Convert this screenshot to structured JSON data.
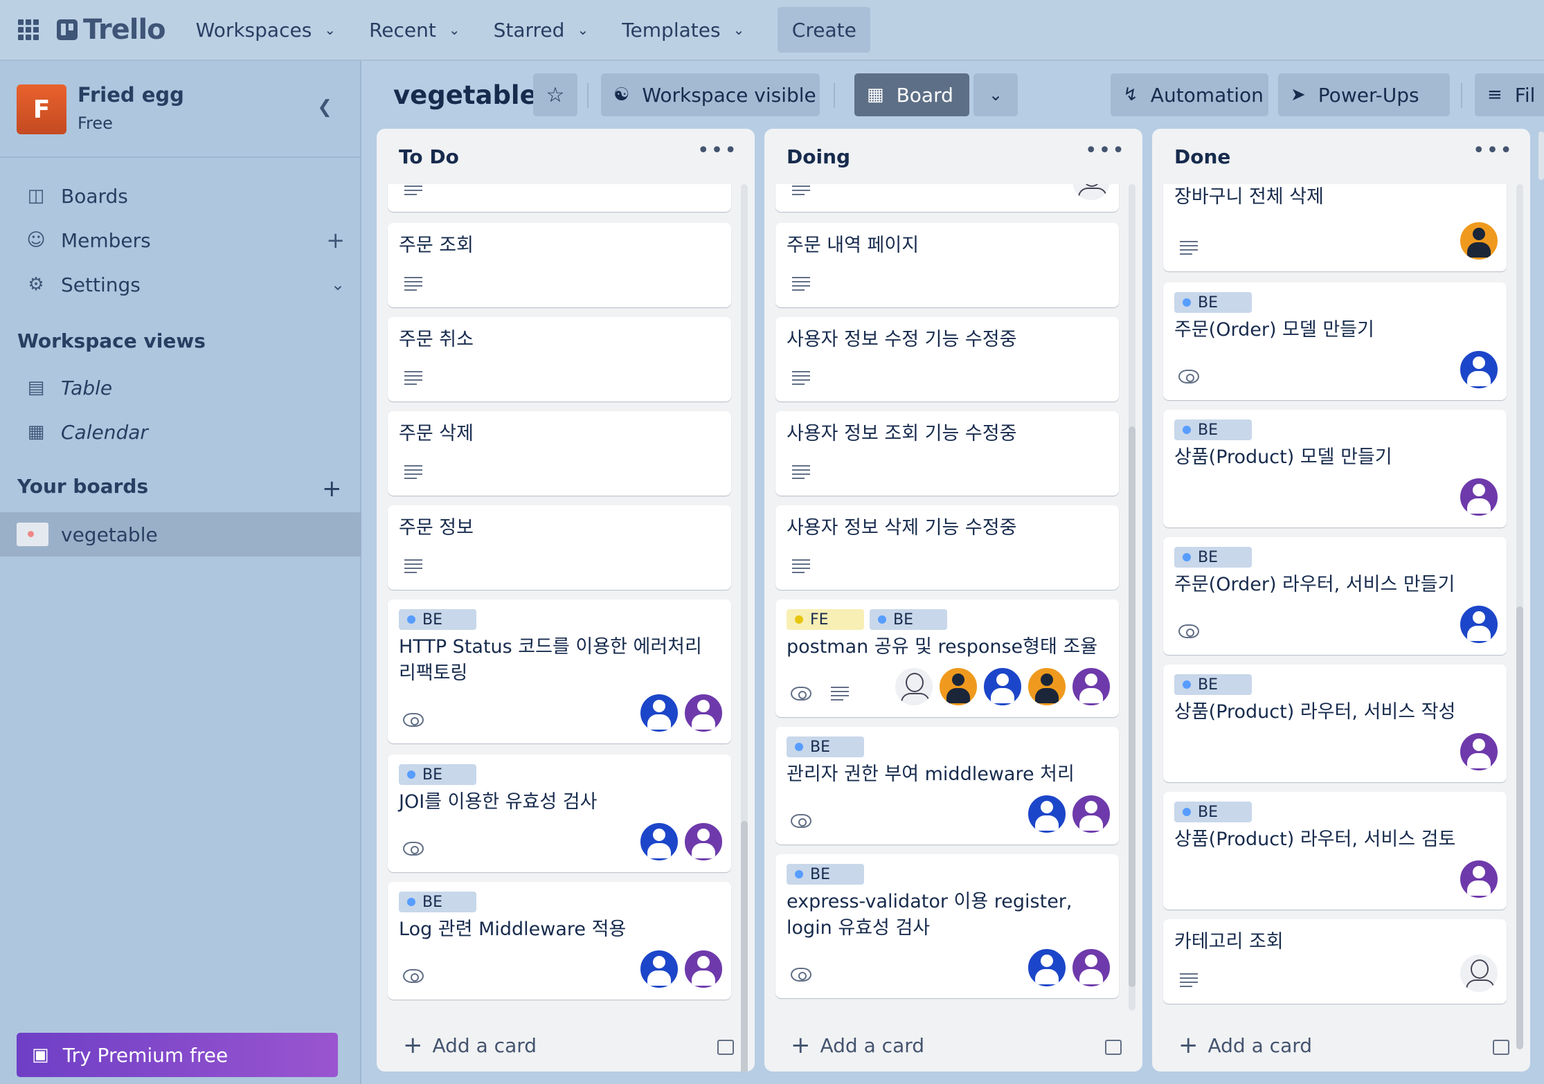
{
  "topbar": {
    "logo": "Trello",
    "nav": [
      "Workspaces",
      "Recent",
      "Starred",
      "Templates"
    ],
    "create": "Create"
  },
  "sidebar": {
    "workspace_initial": "F",
    "workspace_name": "Fried egg",
    "workspace_plan": "Free",
    "items": [
      "Boards",
      "Members",
      "Settings"
    ],
    "views_title": "Workspace views",
    "views": [
      "Table",
      "Calendar"
    ],
    "your_boards_title": "Your boards",
    "boards": [
      "vegetable"
    ],
    "premium": "Try Premium free"
  },
  "board": {
    "title": "vegetable",
    "visibility": "Workspace visible",
    "view": "Board",
    "automation": "Automation",
    "powerups": "Power-Ups",
    "filter": "Fil"
  },
  "lists": [
    {
      "title": "To Do",
      "add": "Add a card",
      "cards": [
        {
          "title": "",
          "labels": [],
          "desc": true,
          "avatars": []
        },
        {
          "title": "주문 조회",
          "labels": [],
          "desc": true,
          "avatars": []
        },
        {
          "title": "주문 취소",
          "labels": [],
          "desc": true,
          "avatars": []
        },
        {
          "title": "주문 삭제",
          "labels": [],
          "desc": true,
          "avatars": []
        },
        {
          "title": "주문 정보",
          "labels": [],
          "desc": true,
          "avatars": []
        },
        {
          "title": "HTTP Status 코드를 이용한 에러처리 리팩토링",
          "labels": [
            "BE"
          ],
          "watch": true,
          "avatars": [
            "blue",
            "purple"
          ]
        },
        {
          "title": "JOI를 이용한 유효성 검사",
          "labels": [
            "BE"
          ],
          "watch": true,
          "avatars": [
            "blue",
            "purple"
          ]
        },
        {
          "title": "Log 관련 Middleware 적용",
          "labels": [
            "BE"
          ],
          "watch": true,
          "avatars": [
            "blue",
            "purple"
          ]
        }
      ]
    },
    {
      "title": "Doing",
      "add": "Add a card",
      "cards": [
        {
          "title": "",
          "labels": [],
          "desc": true,
          "avatars": [
            "face"
          ]
        },
        {
          "title": "주문 내역 페이지",
          "labels": [],
          "desc": true,
          "avatars": []
        },
        {
          "title": "사용자 정보 수정 기능 수정중",
          "labels": [],
          "desc": true,
          "avatars": []
        },
        {
          "title": "사용자 정보 조회 기능 수정중",
          "labels": [],
          "desc": true,
          "avatars": []
        },
        {
          "title": "사용자 정보 삭제 기능 수정중",
          "labels": [],
          "desc": true,
          "avatars": []
        },
        {
          "title": "postman 공유 및 response형태 조율",
          "labels": [
            "FE",
            "BE"
          ],
          "watch": true,
          "desc": true,
          "avatars": [
            "face",
            "orange",
            "blue",
            "orange",
            "purple"
          ]
        },
        {
          "title": "관리자 권한 부여 middleware 처리",
          "labels": [
            "BE"
          ],
          "watch": true,
          "avatars": [
            "blue",
            "purple"
          ]
        },
        {
          "title": "express-validator 이용 register, login 유효성 검사",
          "labels": [
            "BE"
          ],
          "watch": true,
          "avatars": [
            "blue",
            "purple"
          ]
        }
      ]
    },
    {
      "title": "Done",
      "add": "Add a card",
      "cards": [
        {
          "title": "장바구니 전체 삭제",
          "labels": [],
          "desc": true,
          "avatars": [
            "orange"
          ]
        },
        {
          "title": "주문(Order) 모델 만들기",
          "labels": [
            "BE"
          ],
          "watch": true,
          "avatars": [
            "blue"
          ]
        },
        {
          "title": "상품(Product) 모델 만들기",
          "labels": [
            "BE"
          ],
          "avatars": [
            "purple"
          ]
        },
        {
          "title": "주문(Order) 라우터, 서비스 만들기",
          "labels": [
            "BE"
          ],
          "watch": true,
          "avatars": [
            "blue"
          ]
        },
        {
          "title": "상품(Product) 라우터, 서비스 작성",
          "labels": [
            "BE"
          ],
          "avatars": [
            "purple"
          ]
        },
        {
          "title": "상품(Product) 라우터, 서비스 검토",
          "labels": [
            "BE"
          ],
          "avatars": [
            "purple"
          ]
        },
        {
          "title": "카테고리 조회",
          "labels": [],
          "desc": true,
          "avatars": [
            "face"
          ]
        }
      ]
    }
  ]
}
